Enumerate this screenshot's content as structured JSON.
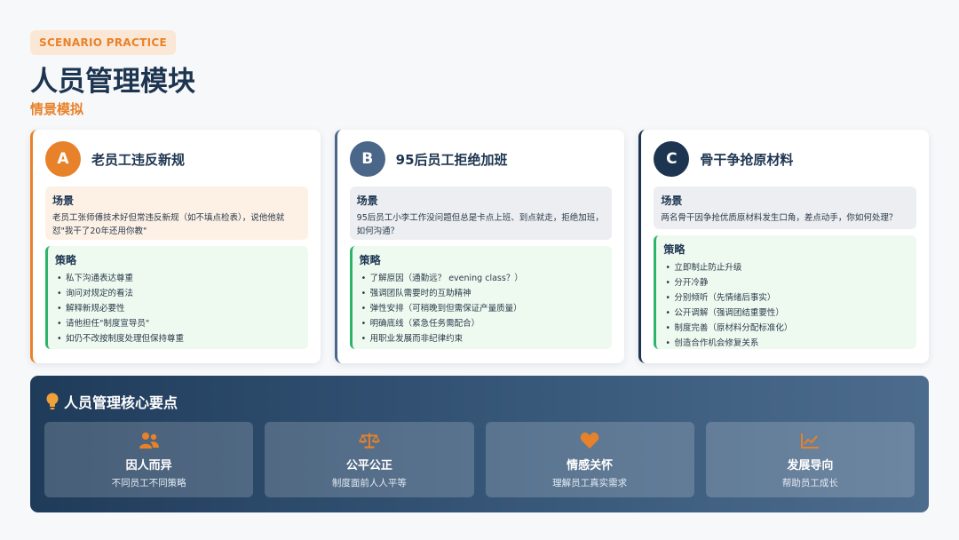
{
  "header": {
    "tag": "SCENARIO PRACTICE",
    "title": "人员管理模块",
    "subtitle": "情景模拟"
  },
  "cards": [
    {
      "letter": "A",
      "title": "老员工违反新规",
      "scene_label": "场景",
      "scene_text": "老员工张师傅技术好但常违反新规（如不填点检表），说他他就怼\"我干了20年还用你教\"",
      "strategy_label": "策略",
      "strategies": [
        "私下沟通表达尊重",
        "询问对规定的看法",
        "解释新规必要性",
        "请他担任\"制度宣导员\"",
        "如仍不改按制度处理但保持尊重"
      ]
    },
    {
      "letter": "B",
      "title": "95后员工拒绝加班",
      "scene_label": "场景",
      "scene_text": "95后员工小李工作没问题但总是卡点上班、到点就走，拒绝加班，如何沟通？",
      "strategy_label": "策略",
      "strategies": [
        "了解原因（通勤远？ evening class？）",
        "强调团队需要时的互助精神",
        "弹性安排（可稍晚到但需保证产量质量）",
        "明确底线（紧急任务需配合）",
        "用职业发展而非纪律约束"
      ]
    },
    {
      "letter": "C",
      "title": "骨干争抢原材料",
      "scene_label": "场景",
      "scene_text": "两名骨干因争抢优质原材料发生口角，差点动手，你如何处理？",
      "strategy_label": "策略",
      "strategies": [
        "立即制止防止升级",
        "分开冷静",
        "分别倾听（先情绪后事实）",
        "公开调解（强调团结重要性）",
        "制度完善（原材料分配标准化）",
        "创造合作机会修复关系"
      ]
    }
  ],
  "panel": {
    "title": "人员管理核心要点",
    "points": [
      {
        "icon": "users-icon",
        "title": "因人而异",
        "desc": "不同员工不同策略"
      },
      {
        "icon": "scale-icon",
        "title": "公平公正",
        "desc": "制度面前人人平等"
      },
      {
        "icon": "heart-icon",
        "title": "情感关怀",
        "desc": "理解员工真实需求"
      },
      {
        "icon": "chart-line-icon",
        "title": "发展导向",
        "desc": "帮助员工成长"
      }
    ]
  },
  "colors": {
    "accent": "#e8822a",
    "navy": "#1d3550",
    "slate": "#4a6688",
    "green": "#2fb36b"
  }
}
